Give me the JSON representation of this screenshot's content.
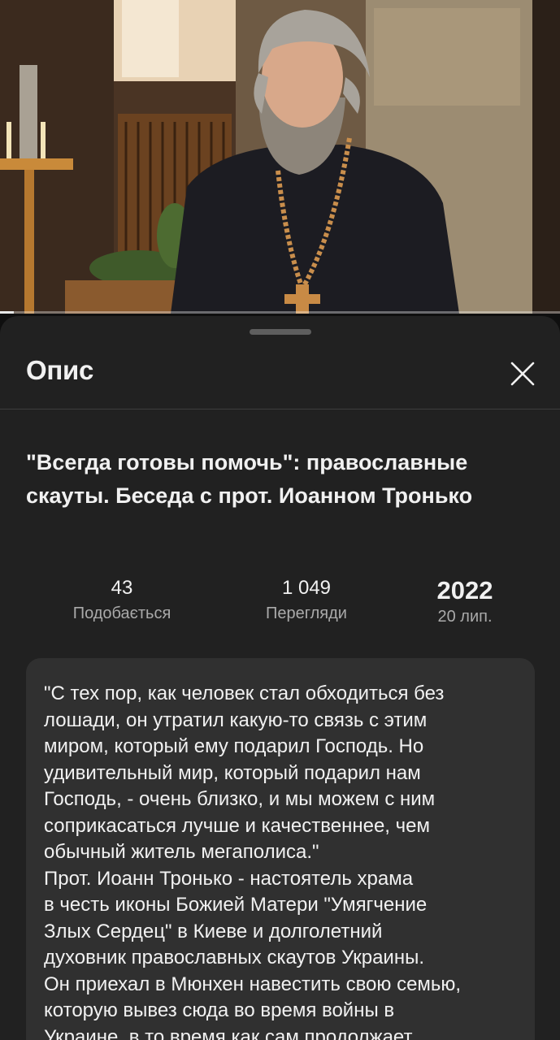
{
  "video": {
    "progress": 0.025
  },
  "sheet": {
    "title": "Опис"
  },
  "video_title": "\"Всегда готовы помочь\": православные скауты. Беседа с прот. Иоанном Тронько",
  "stats": {
    "likes_value": "43",
    "likes_label": "Подобається",
    "views_value": "1 049",
    "views_label": "Перегляди",
    "year": "2022",
    "date": "20 лип."
  },
  "description": {
    "lines": [
      "\"С тех пор, как человек стал обходиться без",
      "лошади, он утратил какую-то связь с этим",
      "миром, который ему подарил Господь. Но",
      "удивительный мир, который подарил нам",
      "Господь, - очень близко, и мы можем с ним",
      "соприкасаться лучше и качественнее, чем",
      "обычный житель мегаполиса.\"",
      "Прот. Иоанн Тронько - настоятель храма",
      "в честь иконы Божией Матери \"Умягчение",
      "Злых Сердец\" в Киеве и долголетний",
      "духовник православных скаутов Украины.",
      "Он приехал в Мюнхен навестить свою семью,",
      "которую вывез сюда во время войны в",
      "Украине, в то время как сам продолжает"
    ]
  },
  "colors": {
    "background": "#0f0f0f",
    "sheet": "#212121",
    "description_box": "#303030",
    "secondary_text": "#aaaaaa"
  },
  "icons": {
    "close": "close-icon"
  }
}
